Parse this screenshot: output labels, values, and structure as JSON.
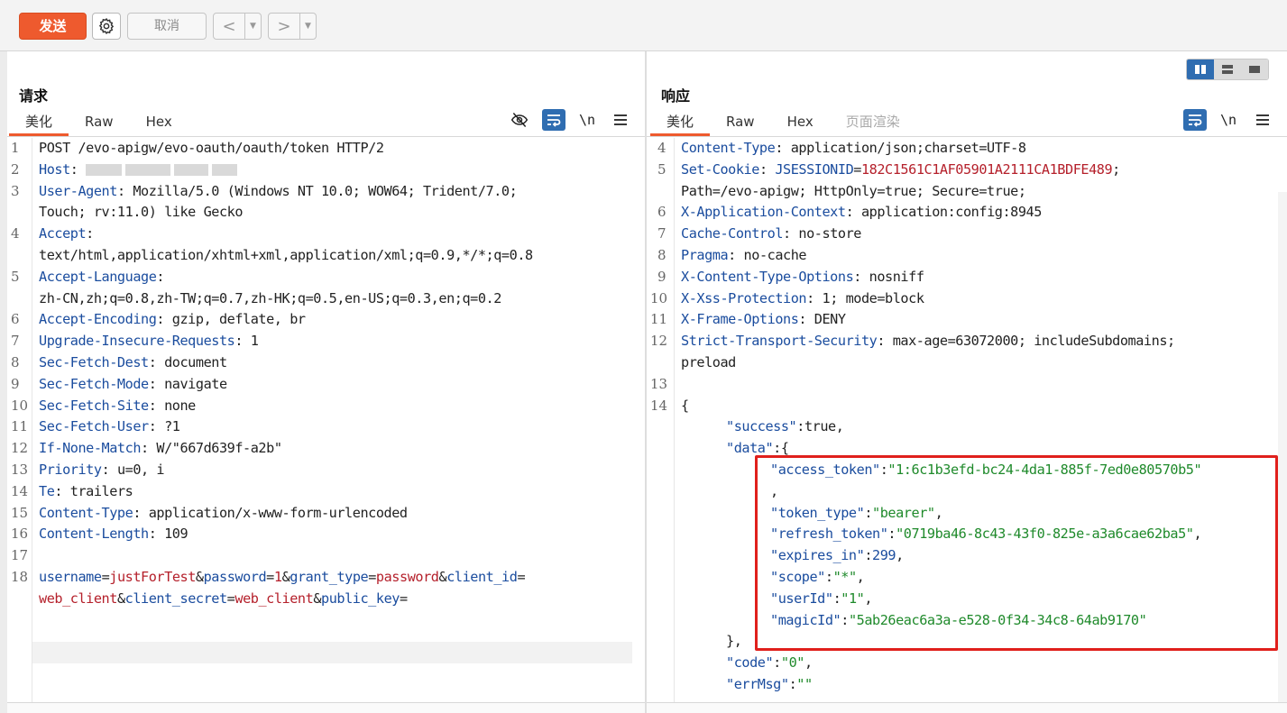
{
  "toolbar": {
    "send_label": "发送",
    "settings_icon": "gear-icon",
    "cancel_label": "取消",
    "back_glyph": "<",
    "forward_glyph": ">",
    "dropdown_glyph": "▼"
  },
  "request": {
    "title": "请求",
    "tabs": [
      "美化",
      "Raw",
      "Hex"
    ],
    "active_tab": "美化",
    "tools": {
      "hide_icon": "eye-off-icon",
      "wrap_icon": "wrap-icon",
      "newline_label": "\\n",
      "menu_icon": "menu-icon"
    },
    "line_numbers": [
      "1",
      "2",
      "3",
      "4",
      "5",
      "6",
      "7",
      "8",
      "9",
      "10",
      "11",
      "12",
      "13",
      "14",
      "15",
      "16",
      "17",
      "18"
    ],
    "lines": {
      "l1": "POST /evo-apigw/evo-oauth/oauth/token HTTP/2",
      "host_k": "Host",
      "ua_k": "User-Agent",
      "ua_v1": ": Mozilla/5.0 (Windows NT 10.0; WOW64; Trident/7.0;",
      "ua_v2": "Touch; rv:11.0) like Gecko",
      "accept_k": "Accept",
      "accept_v": "text/html,application/xhtml+xml,application/xml;q=0.9,*/*;q=0.8",
      "al_k": "Accept-Language",
      "al_v": "zh-CN,zh;q=0.8,zh-TW;q=0.7,zh-HK;q=0.5,en-US;q=0.3,en;q=0.2",
      "ae_k": "Accept-Encoding",
      "ae_v": ": gzip, deflate, br",
      "uir_k": "Upgrade-Insecure-Requests",
      "uir_v": ": 1",
      "sfd_k": "Sec-Fetch-Dest",
      "sfd_v": ": document",
      "sfm_k": "Sec-Fetch-Mode",
      "sfm_v": ": navigate",
      "sfs_k": "Sec-Fetch-Site",
      "sfs_v": ": none",
      "sfu_k": "Sec-Fetch-User",
      "sfu_v": ": ?1",
      "inm_k": "If-None-Match",
      "inm_v": ": W/\"667d639f-a2b\"",
      "pri_k": "Priority",
      "pri_v": ": u=0, i",
      "te_k": "Te",
      "te_v": ": trailers",
      "ct_k": "Content-Type",
      "ct_v": ": application/x-www-form-urlencoded",
      "cl_k": "Content-Length",
      "cl_v": ": 109"
    },
    "body_params": {
      "p1_k": "username",
      "p1_v": "justForTest",
      "p2_k": "password",
      "p2_v": "1",
      "p3_k": "grant_type",
      "p3_v": "password",
      "p4_k": "client_id",
      "p4_v": "web_client",
      "p5_k": "client_secret",
      "p5_v": "web_client",
      "p6_k": "public_key",
      "eq": "=",
      "amp": "&"
    }
  },
  "response": {
    "title": "响应",
    "tabs": [
      "美化",
      "Raw",
      "Hex",
      "页面渲染"
    ],
    "active_tab": "美化",
    "layout_icons": [
      "split-columns-icon",
      "split-rows-icon",
      "single-pane-icon"
    ],
    "tools": {
      "wrap_icon": "wrap-icon",
      "newline_label": "\\n",
      "menu_icon": "menu-icon"
    },
    "line_numbers": [
      "4",
      "5",
      "6",
      "7",
      "8",
      "9",
      "10",
      "11",
      "12",
      "13",
      "14"
    ],
    "lines": {
      "ct_k": "Content-Type",
      "ct_v": ": application/json;charset=UTF-8",
      "sc_k": "Set-Cookie",
      "sc_ck": "JSESSIONID",
      "sc_cv": "182C1561C1AF05901A2111CA1BDFE489",
      "sc_rest": "Path=/evo-apigw; HttpOnly=true; Secure=true;",
      "xac_k": "X-Application-Context",
      "xac_v": ": application:config:8945",
      "cc_k": "Cache-Control",
      "cc_v": ": no-store",
      "pr_k": "Pragma",
      "pr_v": ": no-cache",
      "xcto_k": "X-Content-Type-Options",
      "xcto_v": ": nosniff",
      "xxp_k": "X-Xss-Protection",
      "xxp_v": ": 1; mode=block",
      "xfo_k": "X-Frame-Options",
      "xfo_v": ": DENY",
      "sts_k": "Strict-Transport-Security",
      "sts_v": ": max-age=63072000; includeSubdomains;",
      "sts_v2": "preload"
    },
    "json": {
      "open": "{",
      "success_k": "\"success\"",
      "success_v": "true",
      "data_k": "\"data\"",
      "access_token_k": "\"access_token\"",
      "access_token_v": "\"1:6c1b3efd-bc24-4da1-885f-7ed0e80570b5\"",
      "token_type_k": "\"token_type\"",
      "token_type_v": "\"bearer\"",
      "refresh_token_k": "\"refresh_token\"",
      "refresh_token_v": "\"0719ba46-8c43-43f0-825e-a3a6cae62ba5\"",
      "expires_in_k": "\"expires_in\"",
      "expires_in_v": "299",
      "scope_k": "\"scope\"",
      "scope_v": "\"*\"",
      "userid_k": "\"userId\"",
      "userid_v": "\"1\"",
      "magicid_k": "\"magicId\"",
      "magicid_v": "\"5ab26eac6a3a-e528-0f34-34c8-64ab9170\"",
      "data_close": "},",
      "code_k": "\"code\"",
      "code_v": "\"0\"",
      "errmsg_k": "\"errMsg\"",
      "errmsg_v": "\"\""
    }
  },
  "colors": {
    "accent": "#ee5a2e",
    "header_key": "#1a4c9e",
    "param_value": "#b5202b",
    "json_string": "#1f8a2b",
    "highlight_box": "#e0201c",
    "active_tool": "#2f6db1"
  }
}
